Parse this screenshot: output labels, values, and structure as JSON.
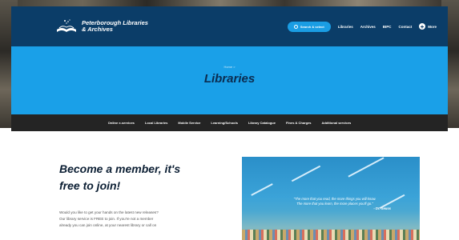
{
  "site": {
    "logo_line1": "Peterborough Libraries",
    "logo_line2": "& Archives"
  },
  "header": {
    "search_label": "Search & select",
    "nav": [
      "Libraries",
      "Archives",
      "BIPC",
      "Contact"
    ],
    "more_label": "More"
  },
  "hero": {
    "breadcrumb": "Home  >",
    "title": "Libraries"
  },
  "subnav": [
    "Online e-services",
    "Local Libraries",
    "Mobile Service",
    "Learning/Schools",
    "Library Catalogue",
    "Fines & Charges",
    "Additional services"
  ],
  "main": {
    "heading_line1": "Become a member, it's",
    "heading_line2": "free to join!",
    "para_line1": "Would you like to get your hands on the latest new releases?",
    "para_line2": "Our library service is FREE to join. If you're not a member",
    "para_line3": "already you can join online, at your nearest library or call on",
    "quote_line1": "\"The more that you read, the more things you will know.",
    "quote_line2": "The more that you learn, the more places you'll go.\"",
    "quote_author": "- Dr. Seuss"
  }
}
